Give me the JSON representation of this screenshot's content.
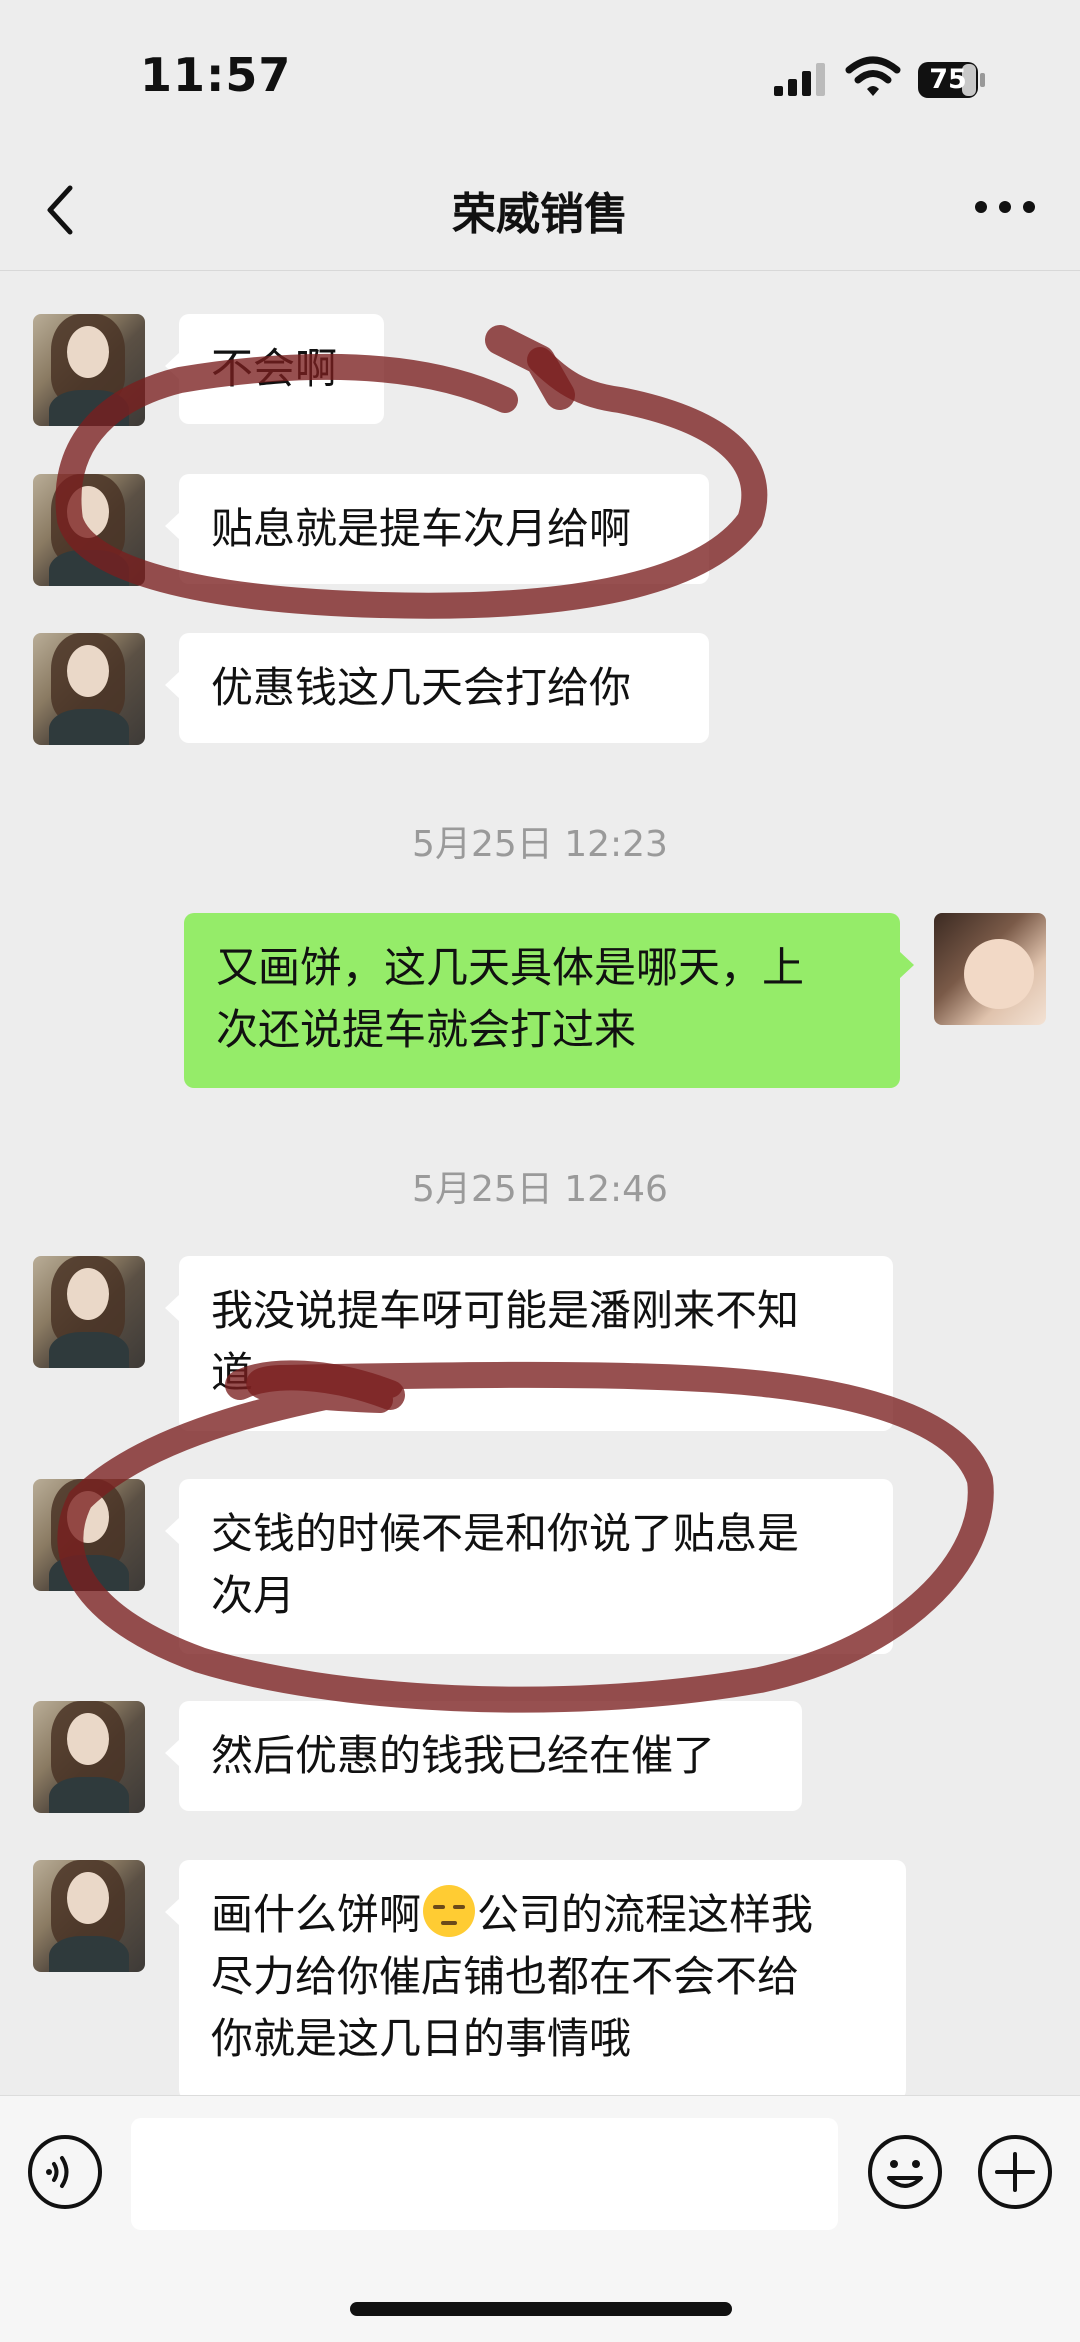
{
  "status_bar": {
    "time": "11:57",
    "battery": "75"
  },
  "nav": {
    "title": "荣威销售",
    "back_icon": "chevron-left-icon",
    "more_icon": "more-dots-icon"
  },
  "messages": [
    {
      "side": "left",
      "text": "不会啊"
    },
    {
      "side": "left",
      "text": "贴息就是提车次月给啊"
    },
    {
      "side": "left",
      "text": "优惠钱这几天会打给你"
    },
    {
      "type": "timestamp",
      "text": "5月25日 12:23"
    },
    {
      "side": "right",
      "lines": [
        "又画饼，这几天具体是哪天，上",
        "次还说提车就会打过来"
      ]
    },
    {
      "type": "timestamp",
      "text": "5月25日 12:46"
    },
    {
      "side": "left",
      "lines": [
        "我没说提车呀可能是潘刚来不知",
        "道"
      ]
    },
    {
      "side": "left",
      "lines": [
        "交钱的时候不是和你说了贴息是",
        "次月"
      ]
    },
    {
      "side": "left",
      "text": "然后优惠的钱我已经在催了"
    },
    {
      "side": "left",
      "part_a": "画什么饼啊",
      "emoji": "pensive-face-emoji",
      "part_b": "公司的流程这样我",
      "lines": [
        "尽力给你催店铺也都在不会不给",
        "你就是这几日的事情哦"
      ]
    }
  ],
  "input_bar": {
    "voice_icon": "voice-icon",
    "emoji_icon": "smiley-icon",
    "plus_icon": "plus-circle-icon",
    "input_value": ""
  },
  "colors": {
    "background": "#ededed",
    "bubble_left": "#ffffff",
    "bubble_right": "#95ec69",
    "annotation": "#7a1f1f"
  }
}
